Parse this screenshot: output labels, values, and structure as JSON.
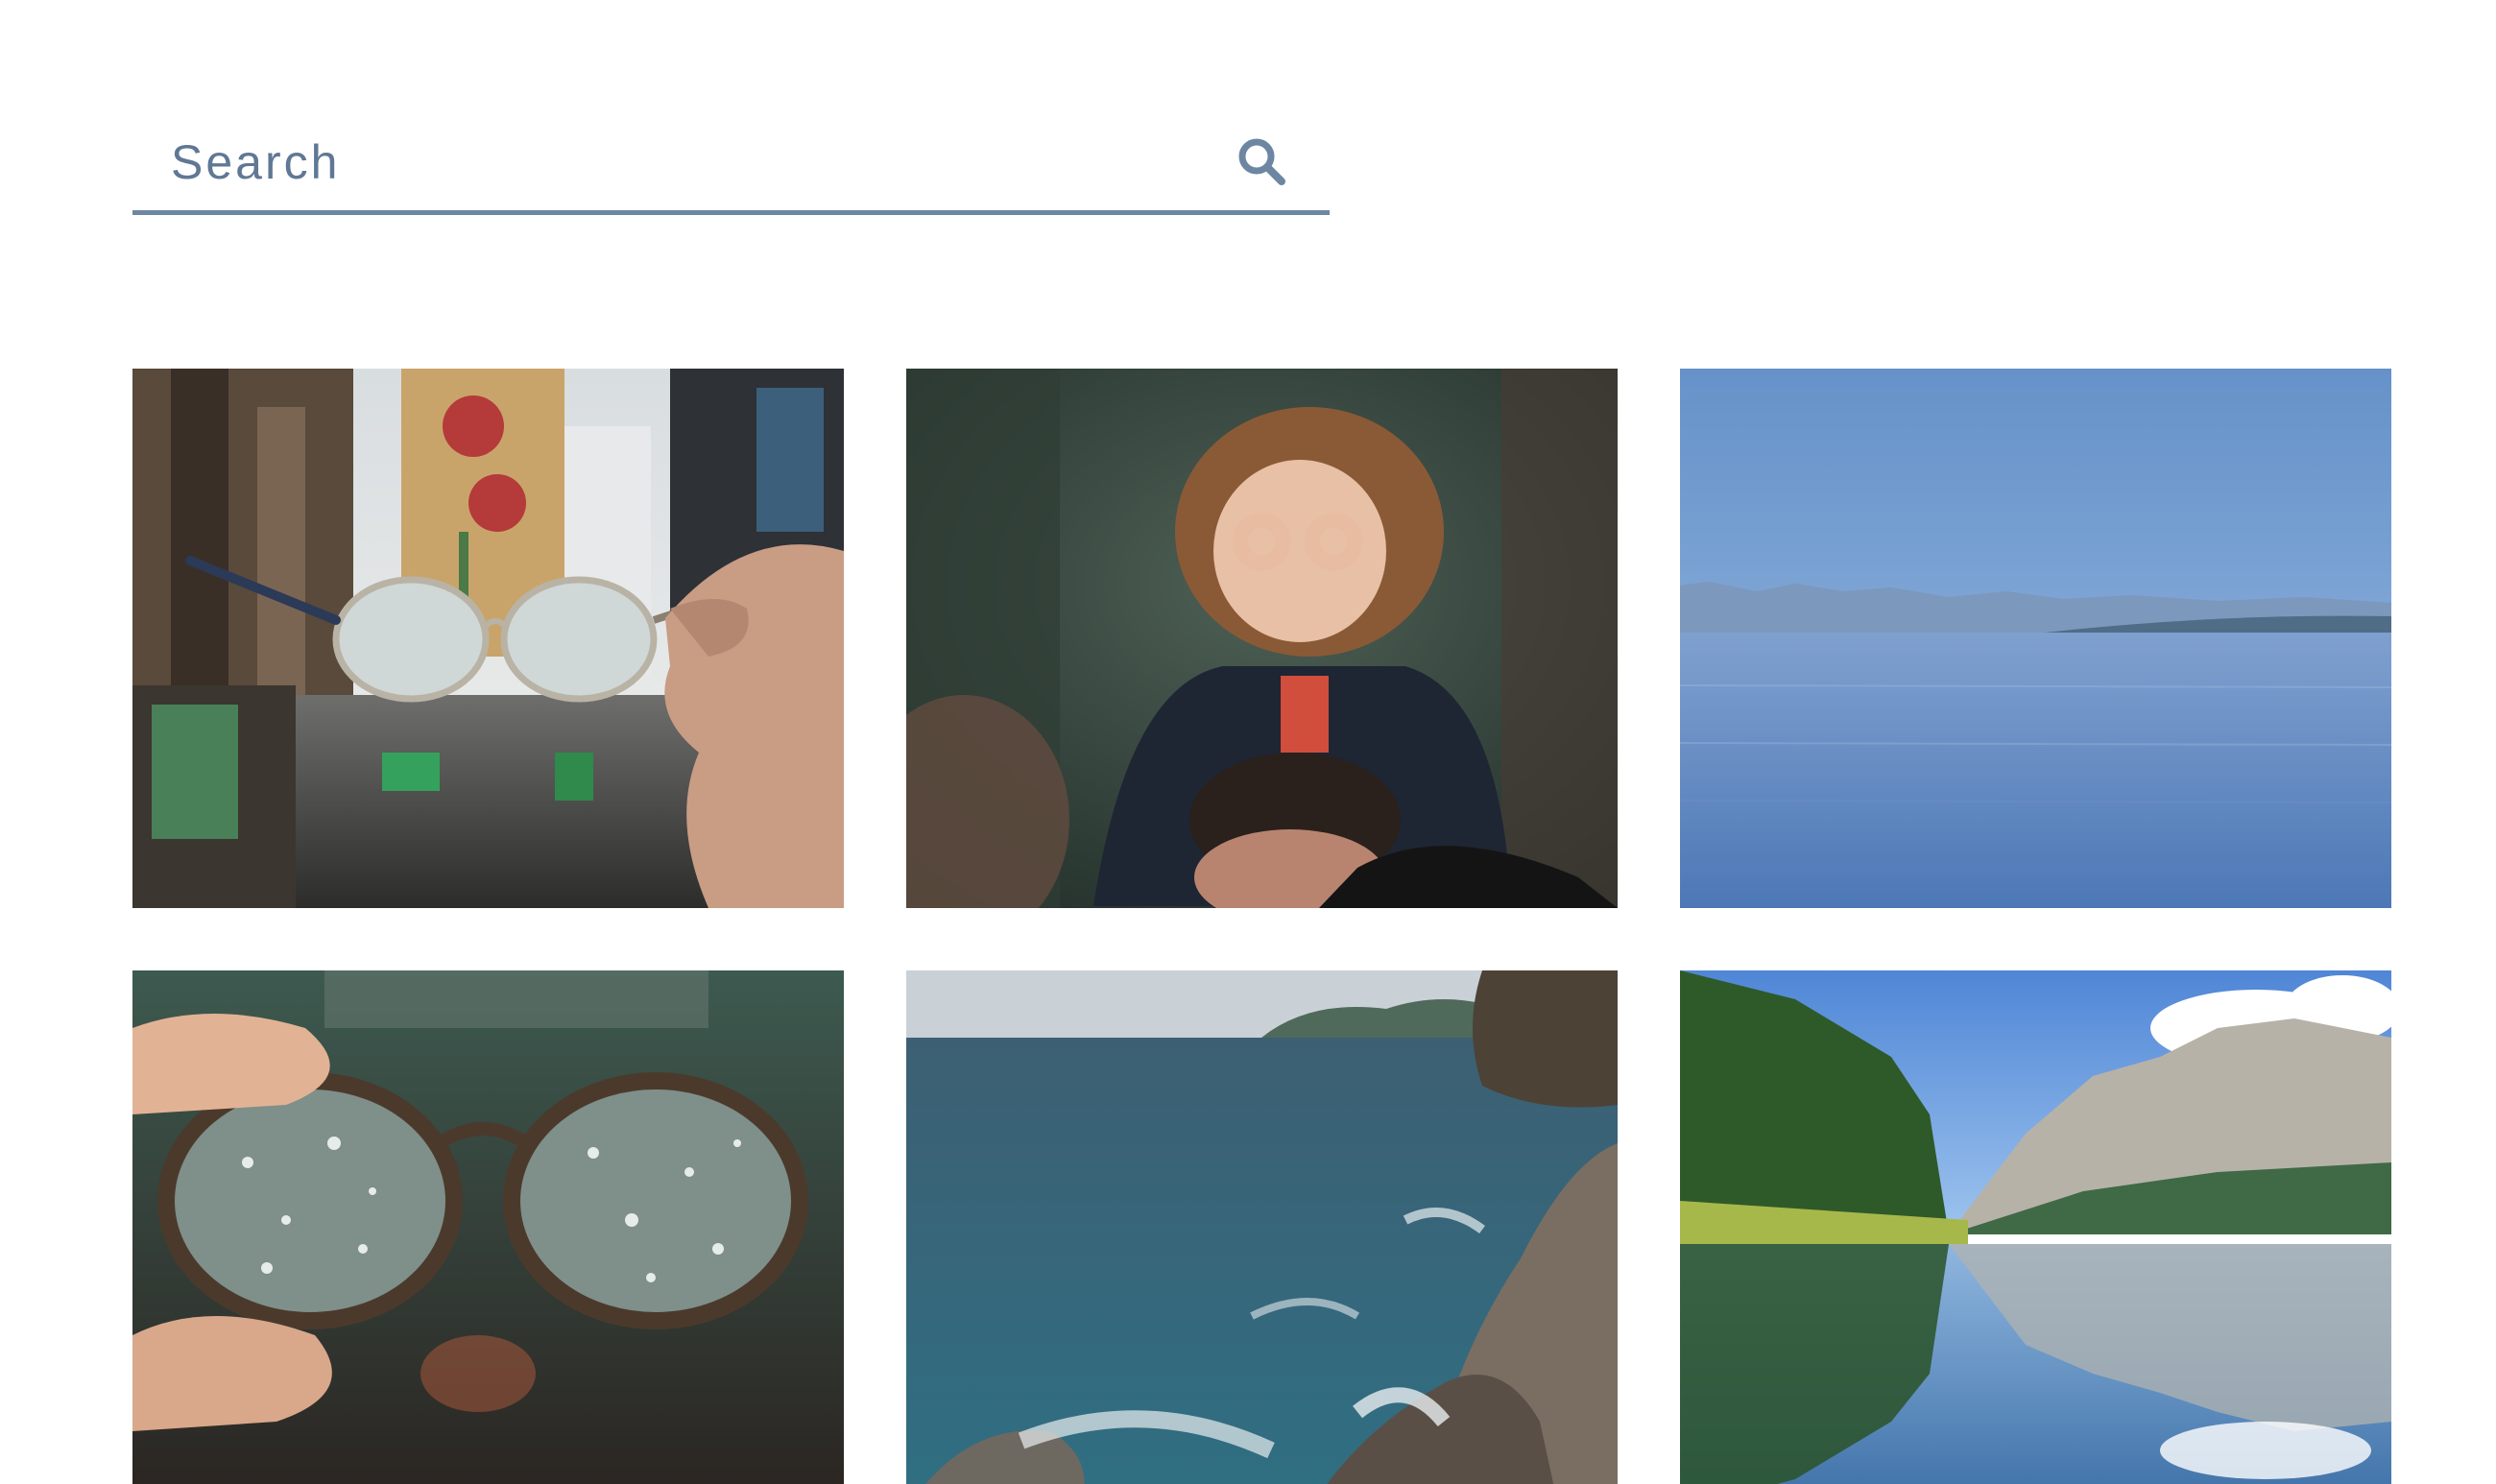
{
  "search": {
    "placeholder": "Search",
    "icon": "search-icon"
  },
  "gallery": {
    "items": [
      {
        "subject": "glasses-street"
      },
      {
        "subject": "girl-binocular-hands"
      },
      {
        "subject": "calm-lake"
      },
      {
        "subject": "rainy-glasses"
      },
      {
        "subject": "rocky-coast"
      },
      {
        "subject": "mountain-lake-reflection"
      }
    ]
  },
  "colors": {
    "accent": "#6d87a3",
    "placeholder": "#5f7894"
  }
}
